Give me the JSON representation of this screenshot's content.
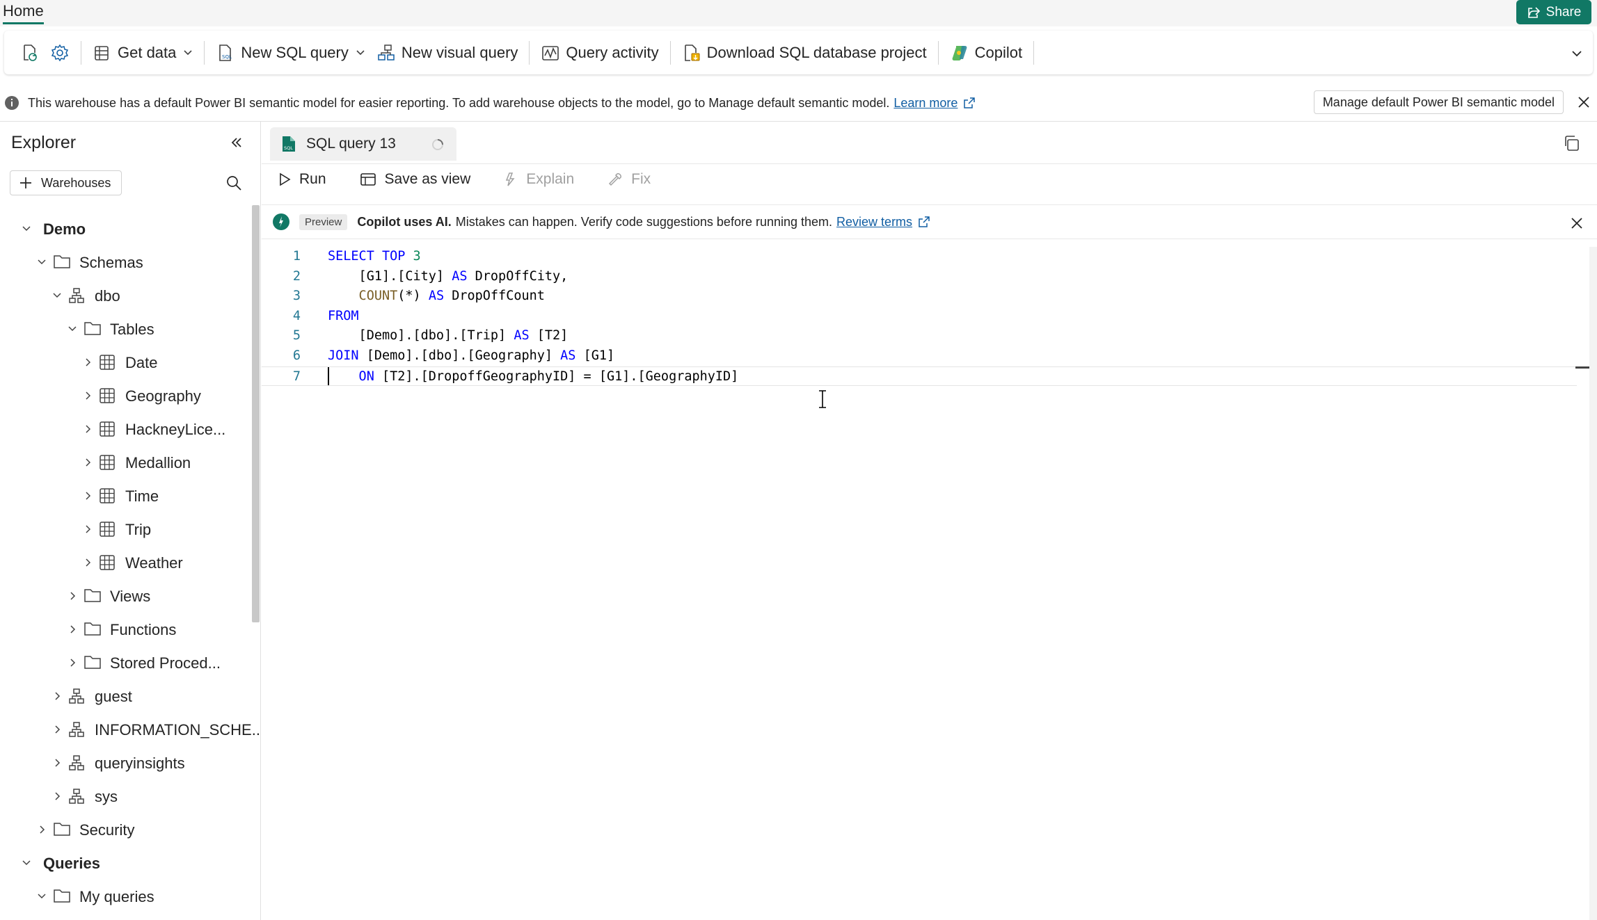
{
  "topbar": {
    "home_tab": "Home",
    "share_label": "Share"
  },
  "ribbon": {
    "get_data": "Get data",
    "new_sql_query": "New SQL query",
    "new_visual_query": "New visual query",
    "query_activity": "Query activity",
    "download_project": "Download SQL database project",
    "copilot": "Copilot"
  },
  "infobar": {
    "message": "This warehouse has a default Power BI semantic model for easier reporting. To add warehouse objects to the model, go to Manage default semantic model.",
    "learn_more": "Learn more",
    "manage_button": "Manage default Power BI semantic model"
  },
  "explorer": {
    "title": "Explorer",
    "add_warehouses": "Warehouses",
    "tree": [
      {
        "label": "Demo",
        "level": 0,
        "expanded": true,
        "icon": "none",
        "bold": true
      },
      {
        "label": "Schemas",
        "level": 1,
        "expanded": true,
        "icon": "folder"
      },
      {
        "label": "dbo",
        "level": 2,
        "expanded": true,
        "icon": "schema"
      },
      {
        "label": "Tables",
        "level": 3,
        "expanded": true,
        "icon": "folder"
      },
      {
        "label": "Date",
        "level": 4,
        "expanded": false,
        "icon": "table"
      },
      {
        "label": "Geography",
        "level": 4,
        "expanded": false,
        "icon": "table"
      },
      {
        "label": "HackneyLice...",
        "level": 4,
        "expanded": false,
        "icon": "table"
      },
      {
        "label": "Medallion",
        "level": 4,
        "expanded": false,
        "icon": "table"
      },
      {
        "label": "Time",
        "level": 4,
        "expanded": false,
        "icon": "table"
      },
      {
        "label": "Trip",
        "level": 4,
        "expanded": false,
        "icon": "table"
      },
      {
        "label": "Weather",
        "level": 4,
        "expanded": false,
        "icon": "table"
      },
      {
        "label": "Views",
        "level": 3,
        "expanded": false,
        "icon": "folder"
      },
      {
        "label": "Functions",
        "level": 3,
        "expanded": false,
        "icon": "folder"
      },
      {
        "label": "Stored Proced...",
        "level": 3,
        "expanded": false,
        "icon": "folder"
      },
      {
        "label": "guest",
        "level": 2,
        "expanded": false,
        "icon": "schema"
      },
      {
        "label": "INFORMATION_SCHE...",
        "level": 2,
        "expanded": false,
        "icon": "schema"
      },
      {
        "label": "queryinsights",
        "level": 2,
        "expanded": false,
        "icon": "schema"
      },
      {
        "label": "sys",
        "level": 2,
        "expanded": false,
        "icon": "schema"
      },
      {
        "label": "Security",
        "level": 1,
        "expanded": false,
        "icon": "folder"
      },
      {
        "label": "Queries",
        "level": 0,
        "expanded": true,
        "icon": "none",
        "bold": true
      },
      {
        "label": "My queries",
        "level": 1,
        "expanded": true,
        "icon": "folder"
      }
    ]
  },
  "editor": {
    "tab_title": "SQL query 13",
    "toolbar": {
      "run": "Run",
      "save_as_view": "Save as view",
      "explain": "Explain",
      "fix": "Fix"
    },
    "copilot_bar": {
      "badge": "Preview",
      "bold": "Copilot uses AI.",
      "text": "Mistakes can happen. Verify code suggestions before running them.",
      "link": "Review terms"
    },
    "code_lines": [
      [
        [
          "kw",
          "SELECT TOP "
        ],
        [
          "num",
          "3"
        ]
      ],
      [
        [
          "id",
          "    [G1].[City] "
        ],
        [
          "kw",
          "AS"
        ],
        [
          "id",
          " DropOffCity,"
        ]
      ],
      [
        [
          "fn",
          "    COUNT"
        ],
        [
          "id",
          "(*) "
        ],
        [
          "kw",
          "AS"
        ],
        [
          "id",
          " DropOffCount"
        ]
      ],
      [
        [
          "kw",
          "FROM"
        ]
      ],
      [
        [
          "id",
          "    [Demo].[dbo].[Trip] "
        ],
        [
          "kw",
          "AS"
        ],
        [
          "id",
          " [T2]"
        ]
      ],
      [
        [
          "kw",
          "JOIN"
        ],
        [
          "id",
          " [Demo].[dbo].[Geography] "
        ],
        [
          "kw",
          "AS"
        ],
        [
          "id",
          " [G1]"
        ]
      ],
      [
        [
          "kw",
          "    ON"
        ],
        [
          "id",
          " [T2].[DropoffGeographyID] = [G1].[GeographyID]"
        ]
      ]
    ],
    "current_line": 7
  },
  "colors": {
    "accent": "#117865",
    "link": "#115ea3",
    "keyword": "#0000ff",
    "function": "#795e26",
    "number": "#098658",
    "line_number": "#237893"
  }
}
